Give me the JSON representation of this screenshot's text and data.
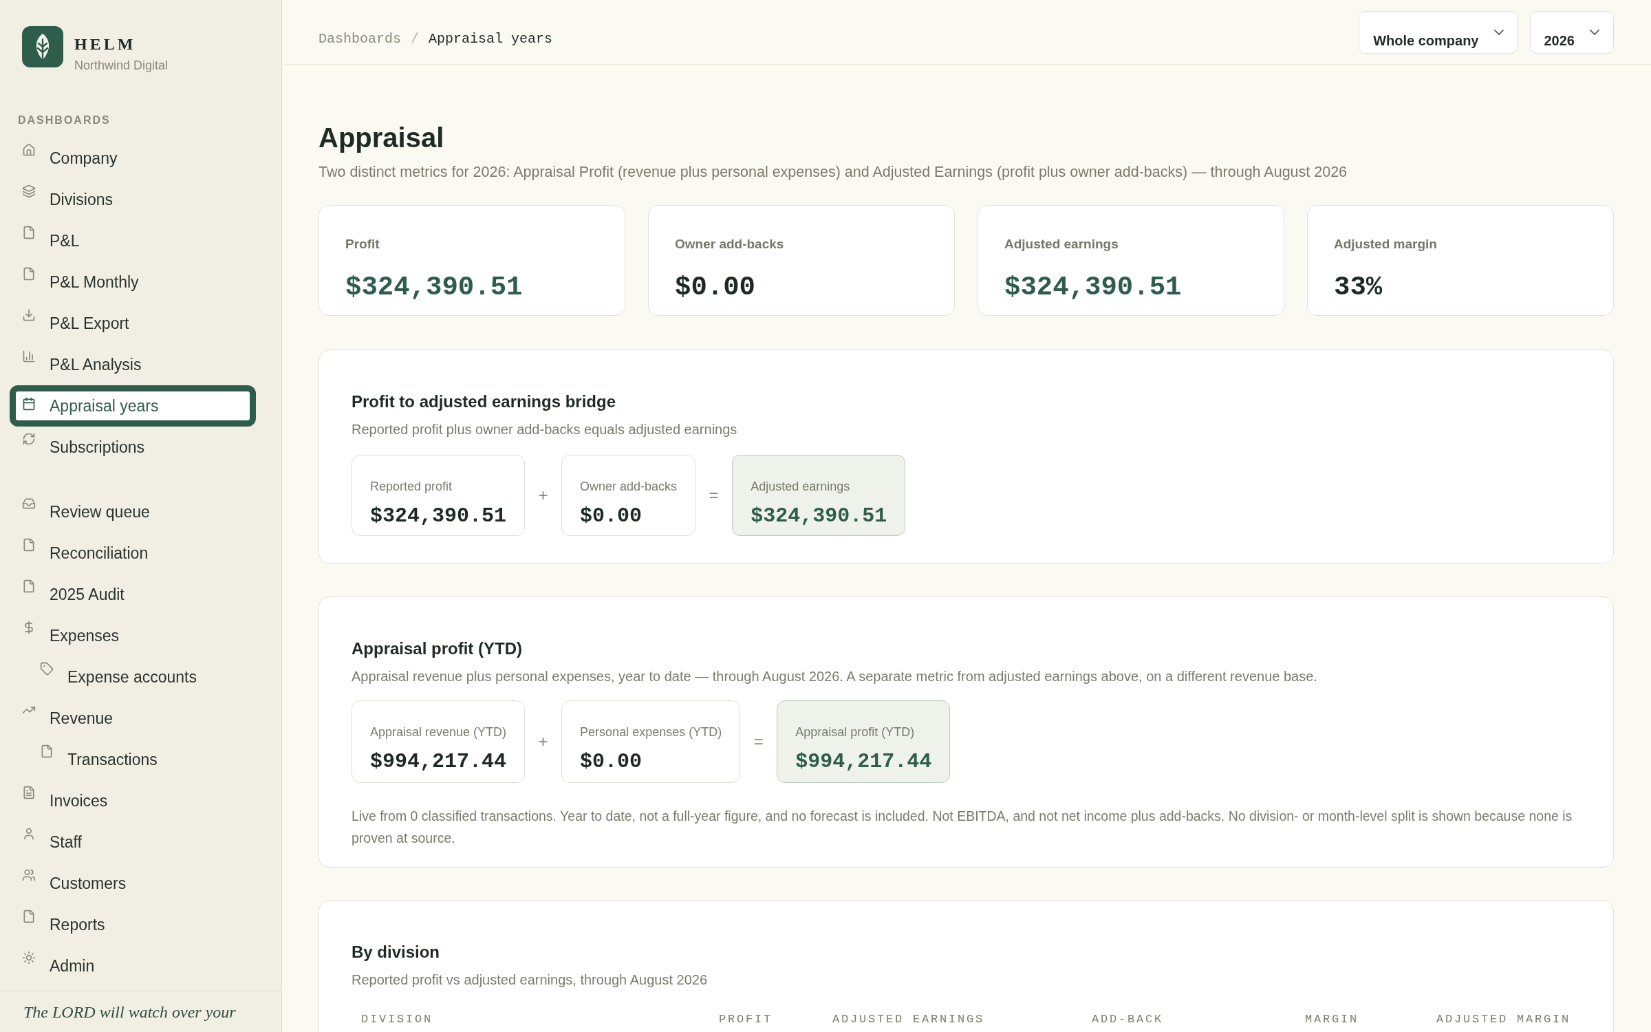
{
  "sidebar": {
    "brand": {
      "name": "HELM",
      "subtitle": "Northwind Digital"
    },
    "groups": [
      {
        "label": "DASHBOARDS",
        "items": [
          {
            "label": "Company",
            "selected": false
          },
          {
            "label": "Divisions",
            "selected": false
          },
          {
            "label": "P&L",
            "selected": false
          },
          {
            "label": "P&L Monthly",
            "selected": false
          },
          {
            "label": "P&L Export",
            "selected": false
          },
          {
            "label": "P&L Analysis",
            "selected": false
          },
          {
            "label": "Appraisal years",
            "selected": true
          },
          {
            "label": "Subscriptions",
            "selected": false
          }
        ]
      },
      {
        "items": [
          {
            "label": "Review queue",
            "selected": false
          },
          {
            "label": "Reconciliation",
            "selected": false
          },
          {
            "label": "2025 Audit",
            "selected": false
          },
          {
            "label": "Expenses",
            "selected": false,
            "children": [
              {
                "label": "Expense accounts",
                "selected": false
              }
            ]
          },
          {
            "label": "Revenue",
            "selected": false,
            "children": [
              {
                "label": "Transactions",
                "selected": false
              }
            ]
          },
          {
            "label": "Invoices",
            "selected": false
          },
          {
            "label": "Staff",
            "selected": false
          },
          {
            "label": "Customers",
            "selected": false
          },
          {
            "label": "Reports",
            "selected": false
          },
          {
            "label": "Admin",
            "selected": false
          }
        ]
      }
    ],
    "footer_quote": "The LORD will watch over your"
  },
  "header": {
    "breadcrumb": {
      "items": [
        "Dashboards",
        "Appraisal years"
      ],
      "separator": "/"
    },
    "filters": [
      {
        "value": "Whole company"
      },
      {
        "value": "2026"
      }
    ]
  },
  "page": {
    "title": "Appraisal",
    "subtitle": "Two distinct metrics for 2026: Appraisal Profit (revenue plus personal expenses) and Adjusted Earnings (profit plus owner add-backs) — through August 2026"
  },
  "stats": [
    {
      "label": "Profit",
      "value": "$324,390.51",
      "accent": true
    },
    {
      "label": "Owner add-backs",
      "value": "$0.00",
      "accent": false
    },
    {
      "label": "Adjusted earnings",
      "value": "$324,390.51",
      "accent": true
    },
    {
      "label": "Adjusted margin",
      "value": "33%",
      "accent": false
    }
  ],
  "bridge": {
    "title": "Profit to adjusted earnings bridge",
    "subtitle": "Reported profit plus owner add-backs equals adjusted earnings",
    "terms": [
      {
        "kind": "term",
        "label": "Reported profit",
        "value": "$324,390.51"
      },
      {
        "kind": "term",
        "operator": "+",
        "label": "Owner add-backs",
        "value": "$0.00"
      },
      {
        "kind": "result",
        "operator": "=",
        "label": "Adjusted earnings",
        "value": "$324,390.51"
      }
    ]
  },
  "appraisal_profit": {
    "title": "Appraisal profit (YTD)",
    "subtitle": "Appraisal revenue plus personal expenses, year to date — through August 2026. A separate metric from adjusted earnings above, on a different revenue base.",
    "terms": [
      {
        "kind": "term",
        "label": "Appraisal revenue (YTD)",
        "value": "$994,217.44"
      },
      {
        "kind": "term",
        "operator": "+",
        "label": "Personal expenses (YTD)",
        "value": "$0.00"
      },
      {
        "kind": "result",
        "operator": "=",
        "label": "Appraisal profit (YTD)",
        "value": "$994,217.44"
      }
    ],
    "note": "Live from 0 classified transactions. Year to date, not a full-year figure, and no forecast is included. Not EBITDA, and not net income plus add-backs. No division- or month-level split is shown because none is proven at source."
  },
  "by_division": {
    "title": "By division",
    "subtitle": "Reported profit vs adjusted earnings, through August 2026",
    "table": {
      "columns": [
        "DIVISION",
        "PROFIT",
        "ADJUSTED EARNINGS",
        "ADD-BACK",
        "MARGIN",
        "ADJUSTED MARGIN"
      ]
    }
  }
}
